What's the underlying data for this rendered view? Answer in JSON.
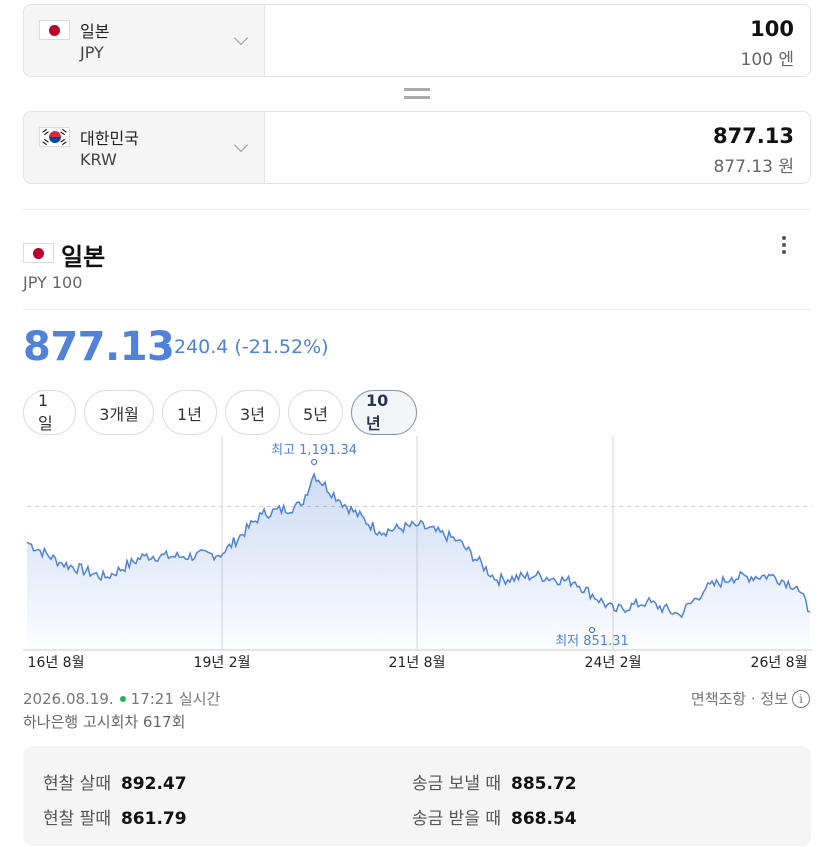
{
  "converter": {
    "from": {
      "country": "일본",
      "code": "JPY",
      "amount": "100",
      "amount_text": "100 엔"
    },
    "to": {
      "country": "대한민국",
      "code": "KRW",
      "amount": "877.13",
      "amount_text": "877.13 원"
    }
  },
  "currency_header": {
    "country": "일본",
    "subtitle": "JPY 100"
  },
  "rate": {
    "value": "877.13",
    "change": "240.4 (-21.52%)",
    "direction": "down",
    "color": "#4f82d8"
  },
  "periods": [
    "1일",
    "3개월",
    "1년",
    "3년",
    "5년",
    "10년"
  ],
  "active_period": "10년",
  "chart_data": {
    "type": "area",
    "x_tick_labels": [
      "16년 8월",
      "19년 2월",
      "21년 8월",
      "24년 2월",
      "26년 8월"
    ],
    "x": [
      "16-08",
      "17-01",
      "17-08",
      "18-02",
      "18-08",
      "19-02",
      "19-08",
      "20-02",
      "20-04",
      "20-08",
      "21-02",
      "21-08",
      "22-02",
      "22-08",
      "23-02",
      "23-08",
      "24-02",
      "24-07",
      "24-12",
      "25-04",
      "25-08",
      "26-02",
      "26-06",
      "26-08"
    ],
    "y": [
      1036,
      990,
      955,
      1005,
      1003,
      1010,
      1100,
      1120,
      1191.34,
      1130,
      1060,
      1075,
      1040,
      950,
      960,
      945,
      880,
      900,
      870,
      930,
      955,
      960,
      935,
      877.13
    ],
    "high": {
      "label": "최고 1,191.34",
      "value": 1191.34
    },
    "low": {
      "label": "최저 851.31",
      "value": 851.31
    },
    "reference_line": 1117.53,
    "ylim": [
      790,
      1260
    ],
    "line_color": "#4f82d8",
    "grid": "vertical"
  },
  "footer": {
    "date": "2026.08.19.",
    "time": "17:21",
    "live": "실시간",
    "notice": "하나은행 고시회차 617회",
    "disclaimer": "면책조항 · 정보",
    "info_icon": "i"
  },
  "rates": [
    {
      "label": "현찰 살때",
      "value": "892.47"
    },
    {
      "label": "송금 보낼 때",
      "value": "885.72"
    },
    {
      "label": "현찰 팔때",
      "value": "861.79"
    },
    {
      "label": "송금 받을 때",
      "value": "868.54"
    }
  ]
}
